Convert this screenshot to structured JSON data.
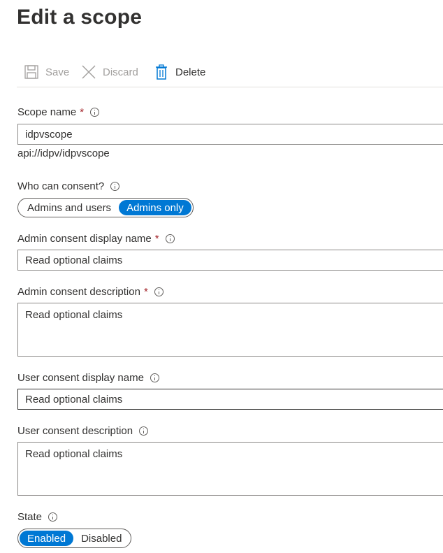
{
  "page": {
    "title": "Edit a scope"
  },
  "toolbar": {
    "save_label": "Save",
    "discard_label": "Discard",
    "delete_label": "Delete"
  },
  "scope_name": {
    "label": "Scope name",
    "required_mark": "*",
    "value": "idpvscope",
    "uri": "api://idpv/idpvscope"
  },
  "who_can_consent": {
    "label": "Who can consent?",
    "options": [
      "Admins and users",
      "Admins only"
    ],
    "selected": "Admins only"
  },
  "admin_display_name": {
    "label": "Admin consent display name",
    "required_mark": "*",
    "value": "Read optional claims"
  },
  "admin_description": {
    "label": "Admin consent description",
    "required_mark": "*",
    "value": "Read optional claims"
  },
  "user_display_name": {
    "label": "User consent display name",
    "value": "Read optional claims"
  },
  "user_description": {
    "label": "User consent description",
    "value": "Read optional claims"
  },
  "state": {
    "label": "State",
    "options": [
      "Enabled",
      "Disabled"
    ],
    "selected": "Enabled"
  },
  "colors": {
    "accent": "#0078d4",
    "required": "#a4262c",
    "text": "#323130",
    "disabled_text": "#a19f9d",
    "border": "#8a8886"
  },
  "icons": {
    "save": "save-icon",
    "discard": "discard-x-icon",
    "delete": "trash-icon",
    "info": "info-icon"
  }
}
